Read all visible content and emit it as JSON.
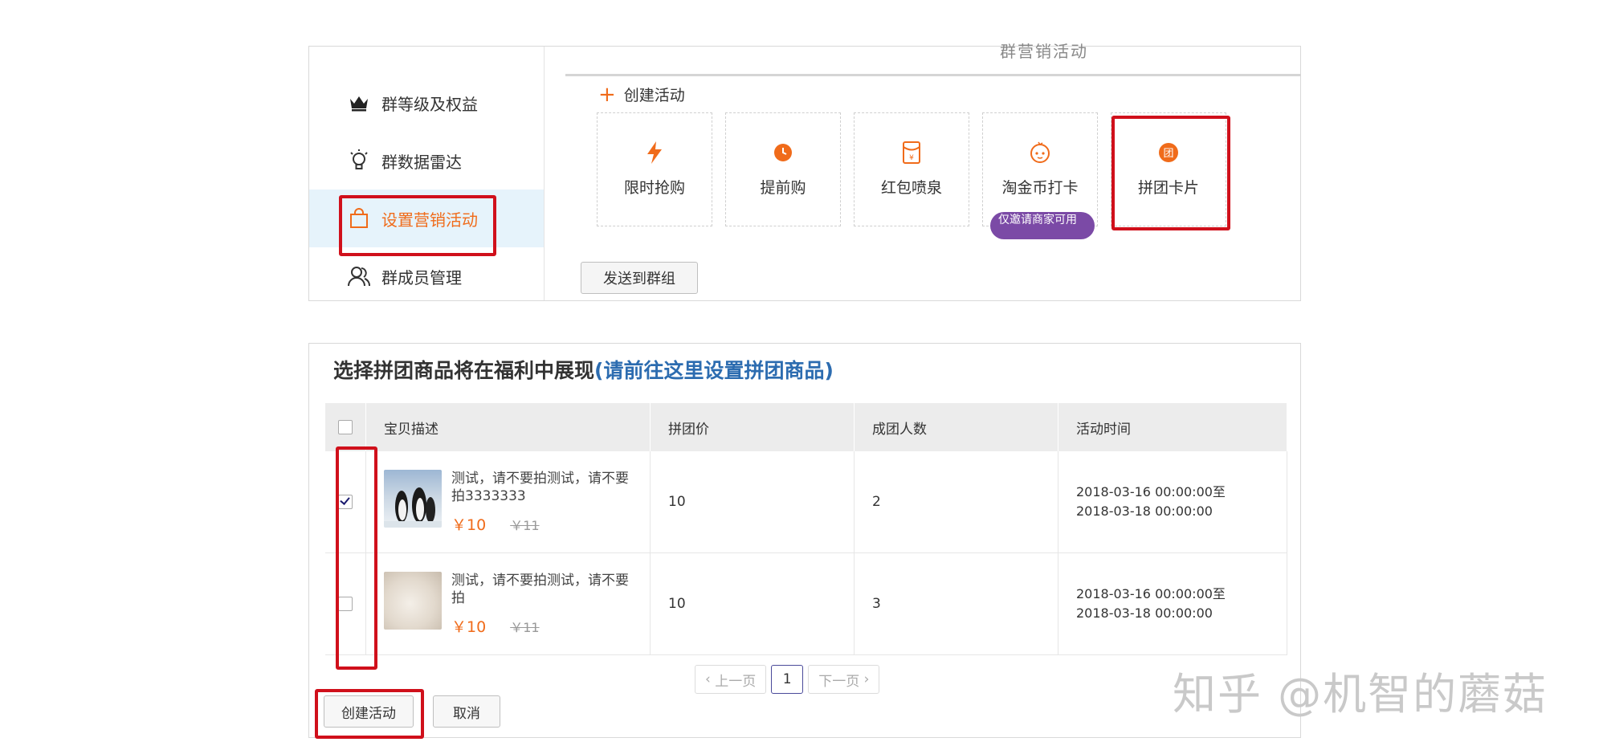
{
  "top": {
    "cutoff_text": "群营销活动",
    "sidebar": {
      "items": [
        {
          "label": "群等级及权益",
          "icon": "crown-icon"
        },
        {
          "label": "群数据雷达",
          "icon": "bulb-icon"
        },
        {
          "label": "设置营销活动",
          "icon": "bag-icon",
          "active": true
        },
        {
          "label": "群成员管理",
          "icon": "members-icon"
        }
      ]
    },
    "create_activity_label": "创建活动",
    "activity_cards": [
      {
        "label": "限时抢购",
        "icon": "lightning-icon"
      },
      {
        "label": "提前购",
        "icon": "clock-icon"
      },
      {
        "label": "红包喷泉",
        "icon": "red-envelope-icon"
      },
      {
        "label": "淘金币打卡",
        "icon": "coin-face-icon"
      },
      {
        "label": "拼团卡片",
        "icon": "group-buy-icon"
      }
    ],
    "invite_badge": "仅邀请商家可用",
    "send_button": "发送到群组"
  },
  "bottom": {
    "title": "选择拼团商品将在福利中展现",
    "title_link": "(请前往这里设置拼团商品)",
    "table": {
      "headers": [
        "宝贝描述",
        "拼团价",
        "成团人数",
        "活动时间"
      ],
      "rows": [
        {
          "checked": true,
          "title": "测试，请不要拍测试，请不要拍3333333",
          "price": "￥10",
          "orig_price": "￥11",
          "group_price": "10",
          "group_size": "2",
          "time": "2018-03-16 00:00:00至2018-03-18 00:00:00"
        },
        {
          "checked": false,
          "title": "测试，请不要拍测试，请不要拍",
          "price": "￥10",
          "orig_price": "￥11",
          "group_price": "10",
          "group_size": "3",
          "time": "2018-03-16 00:00:00至2018-03-18 00:00:00"
        }
      ]
    },
    "pager": {
      "prev": "上一页",
      "current": "1",
      "next": "下一页"
    },
    "create_button": "创建活动",
    "cancel_button": "取消"
  },
  "watermark": "知乎 @机智的蘑菇",
  "colors": {
    "accent": "#f06b1a",
    "highlight": "#d0101b",
    "link": "#2c6cb0",
    "badge": "#7b4aa6",
    "active_bg": "#e6f3fb"
  }
}
